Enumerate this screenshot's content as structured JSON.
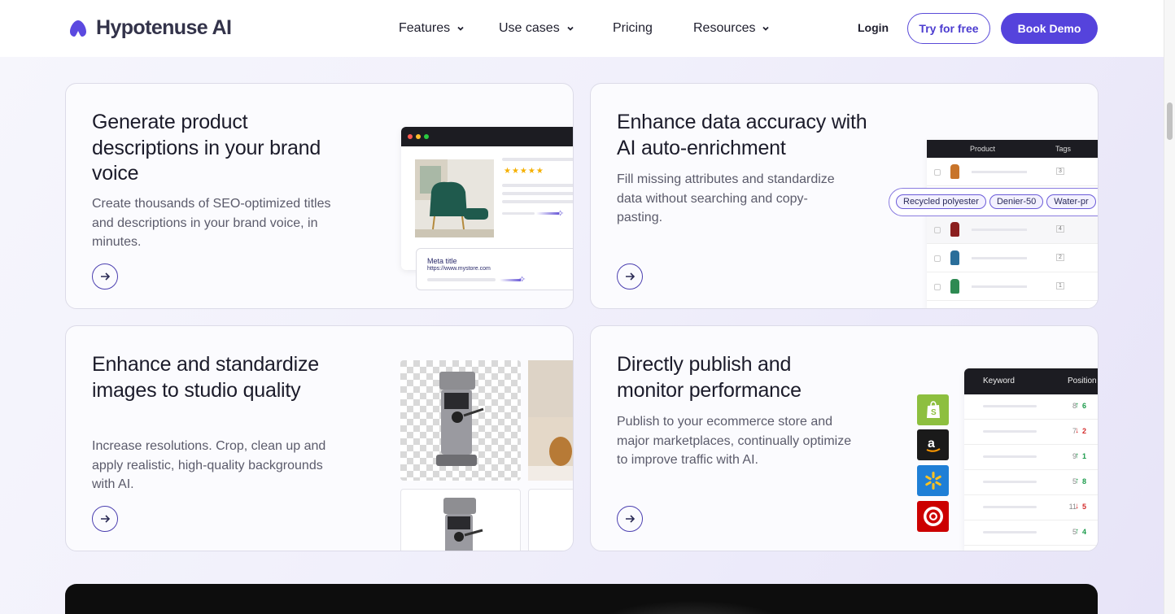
{
  "nav": {
    "logo_text": "Hypotenuse AI",
    "menu": [
      {
        "label": "Features",
        "has_dropdown": true
      },
      {
        "label": "Use cases",
        "has_dropdown": true
      },
      {
        "label": "Pricing",
        "has_dropdown": false
      },
      {
        "label": "Resources",
        "has_dropdown": true
      }
    ],
    "login_label": "Login",
    "try_label": "Try for free",
    "demo_label": "Book Demo"
  },
  "cards": [
    {
      "title": "Generate product descriptions in your brand voice",
      "description": "Create thousands of SEO-optimized titles and descriptions in your brand voice, in minutes.",
      "meta_title": "Meta title",
      "meta_url": "https://www.mystore.com"
    },
    {
      "title": "Enhance data accuracy with AI auto-enrichment",
      "description": "Fill missing attributes and standardize data without searching and copy-pasting.",
      "table_headers": [
        "Product",
        "Tags"
      ],
      "tags": [
        "Recycled polyester",
        "Denier-50",
        "Water-pr"
      ],
      "row_counts": [
        "3",
        "4",
        "2",
        "1"
      ]
    },
    {
      "title": "Enhance and standardize images to studio quality",
      "description": "Increase resolutions. Crop, clean up and apply realistic, high-quality backgrounds with AI."
    },
    {
      "title": "Directly publish and monitor performance",
      "description": "Publish to your ecommerce store and major marketplaces, continually optimize to improve traffic with AI.",
      "table_headers": [
        "Keyword",
        "Position"
      ],
      "positions": [
        {
          "pos": "8",
          "change": "6",
          "dir": "up"
        },
        {
          "pos": "7",
          "change": "2",
          "dir": "down"
        },
        {
          "pos": "9",
          "change": "1",
          "dir": "up"
        },
        {
          "pos": "5",
          "change": "8",
          "dir": "up"
        },
        {
          "pos": "11",
          "change": "5",
          "dir": "down"
        },
        {
          "pos": "5",
          "change": "4",
          "dir": "up"
        }
      ]
    }
  ],
  "colors": {
    "accent": "#5543dc",
    "up": "#1a9a4a",
    "down": "#d42b2b"
  }
}
